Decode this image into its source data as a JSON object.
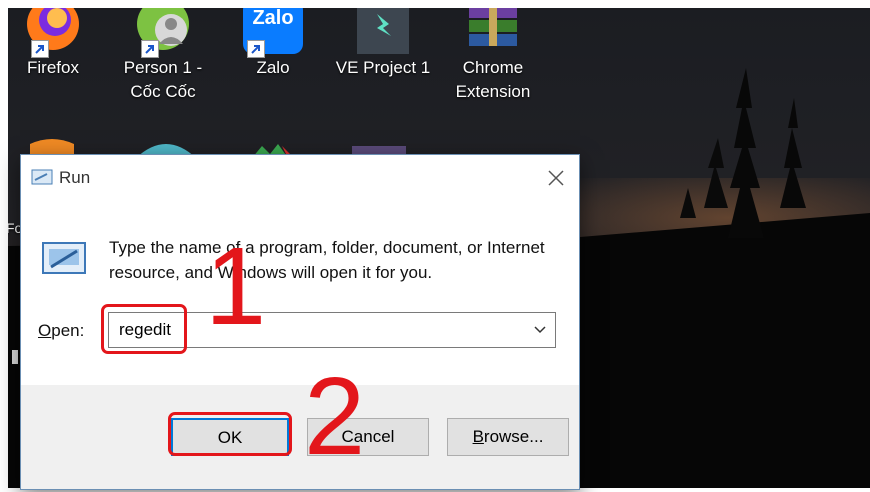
{
  "desktop": {
    "icons": [
      {
        "label": "Firefox",
        "icon": "firefox-icon"
      },
      {
        "label": "Person 1 -",
        "label2": "Cốc Cốc",
        "icon": "coccoc-icon"
      },
      {
        "label": "Zalo",
        "icon": "zalo-icon",
        "logo_text": "Zalo"
      },
      {
        "label": "VE Project 1",
        "icon": "filmora-icon"
      },
      {
        "label": "Chrome",
        "label2": "Extension",
        "icon": "winrar-icon"
      }
    ],
    "stray_text": "Fo"
  },
  "dialog": {
    "title": "Run",
    "description": "Type the name of a program, folder, document, or Internet resource, and Windows will open it for you.",
    "open_label_underlined": "O",
    "open_label_rest": "pen:",
    "input_value": "regedit",
    "ok_label": "OK",
    "cancel_label": "Cancel",
    "browse_label_underlined": "B",
    "browse_label_rest": "rowse..."
  },
  "annotations": {
    "step1": "1",
    "step2": "2",
    "color": "#e3161b"
  },
  "colors": {
    "ok_border": "#0078d7",
    "footer_bg": "#f0f0f0"
  }
}
